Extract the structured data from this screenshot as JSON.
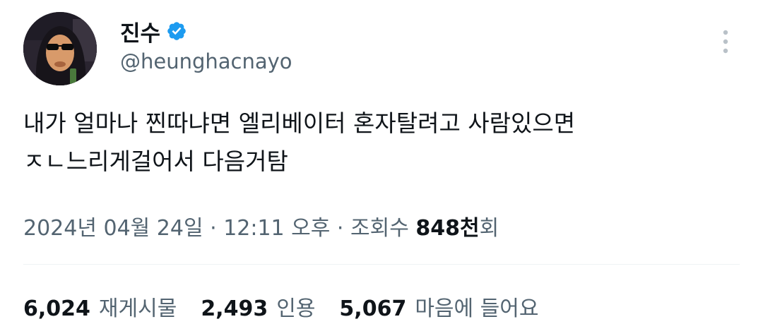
{
  "author": {
    "display_name": "진수",
    "handle": "@heunghacnayo",
    "verified": true,
    "badge_color": "#1d9bf0"
  },
  "tweet": {
    "text_line1": "내가 얼마나 찐따냐면 엘리베이터 혼자탈려고 사람있으면",
    "text_line2": "ㅈㄴ느리게걸어서 다음거탐"
  },
  "meta": {
    "date": "2024년 04월 24일",
    "sep1": " · ",
    "time": "12:11 오후",
    "sep2": " · ",
    "views_label": "조회수 ",
    "views_count": "848천",
    "views_suffix": "회"
  },
  "stats": {
    "retweets": {
      "count": "6,024",
      "label": "재게시물"
    },
    "quotes": {
      "count": "2,493",
      "label": "인용"
    },
    "likes": {
      "count": "5,067",
      "label": "마음에 들어요"
    }
  },
  "icons": {
    "avatar": "avatar-image",
    "verified": "verified-badge-icon",
    "more": "more-options-icon"
  }
}
